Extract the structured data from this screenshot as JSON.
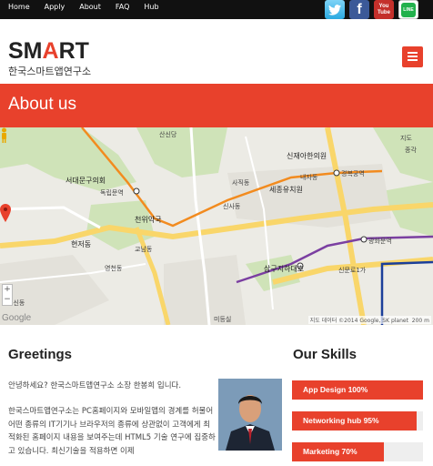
{
  "nav": {
    "links": [
      "Home",
      "Apply",
      "About",
      "FAQ",
      "Hub"
    ],
    "social": {
      "twitter": "twitter-icon",
      "facebook": "facebook-icon",
      "youtube_top": "You",
      "youtube_bottom": "Tube",
      "line": "LINE"
    }
  },
  "header": {
    "logo_pre": "SM",
    "logo_accent": "A",
    "logo_post": "RT",
    "logo_sub": "한국스마트앱연구소",
    "menu_icon": "hamburger-icon"
  },
  "banner": {
    "title": "About us"
  },
  "map": {
    "labels": {
      "sansin": "산신당",
      "sinchon": "신재아한의원",
      "seodaemun_gu": "서대문구의회",
      "dongnimmun": "독립문역",
      "gyeongbok": "경복궁역",
      "naeja": "내자동",
      "sejong": "세종유치원",
      "sajik": "사직동",
      "sinsa": "신사동",
      "chunhyeon": "천위약국",
      "hyeonjeo": "현저동",
      "gyonam": "교남동",
      "yeongcheon": "영천동",
      "gwanghwamun": "광화문역",
      "sinmunno": "신문로1가",
      "samgu": "삼구지하대호",
      "daesin": "대신동",
      "misamsil": "미등실",
      "jido": "지도",
      "jonggak": "종각",
      "map_credit": "지도 데이터 ©2014 Google, SK planet",
      "scale": "200 m",
      "google": "Google"
    }
  },
  "greetings": {
    "title": "Greetings",
    "p1": "안녕하세요? 한국스마트앱연구소 소장 한봉희 입니다.",
    "p2": "한국스마트앱연구소는 PC홈페이지와 모바일앱의 경계를 허물어 어떤 종류의 IT기기나 브라우저의 종류에 상관없이 고객에게 최적화된 홈페이지 내용을 보여주는데 HTML5 기술 연구에 집중하고 있습니다. 최신기술을 적용하면 이제"
  },
  "skills": {
    "title": "Our Skills",
    "items": [
      {
        "label": "App Design 100%",
        "percent": 100
      },
      {
        "label": "Networking hub 95%",
        "percent": 95
      },
      {
        "label": "Marketing 70%",
        "percent": 70
      }
    ]
  },
  "colors": {
    "accent": "#e8412c",
    "nav_bg": "#111111"
  }
}
